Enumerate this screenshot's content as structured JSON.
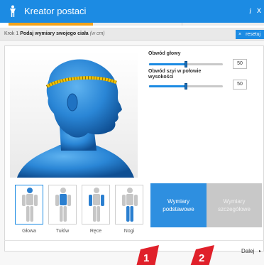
{
  "window": {
    "title": "Kreator postaci",
    "info_glyph": "i",
    "close_glyph": "x"
  },
  "progress": {
    "fraction": 0.33,
    "accent": "#f4a31a"
  },
  "step": {
    "prefix": "Krok 1",
    "title": "Podaj wymiary swojego ciała",
    "unit": "(w cm)",
    "reset_glyph": "×",
    "reset_label": "resetuj"
  },
  "controls": [
    {
      "label": "Obwód głowy",
      "value": "50",
      "fraction": 0.5
    },
    {
      "label": "Obwód szyi w połowie wysokości",
      "value": "50",
      "fraction": 0.5
    }
  ],
  "body_parts": [
    {
      "label": "Głowa",
      "selected": true,
      "highlight": "head"
    },
    {
      "label": "Tułów",
      "selected": false,
      "highlight": "torso"
    },
    {
      "label": "Ręce",
      "selected": false,
      "highlight": "arms"
    },
    {
      "label": "Nogi",
      "selected": false,
      "highlight": "legs"
    }
  ],
  "modes": {
    "basic_label": "Wymiary podstawowe",
    "detailed_label": "Wymiary szczegółowe"
  },
  "footer": {
    "next_label": "Dalej",
    "next_glyph": "▸"
  },
  "markers": [
    {
      "number": "1"
    },
    {
      "number": "2"
    }
  ],
  "colors": {
    "brand": "#1c8be3",
    "marker": "#e0202a",
    "figure": "#2a7fd0"
  }
}
